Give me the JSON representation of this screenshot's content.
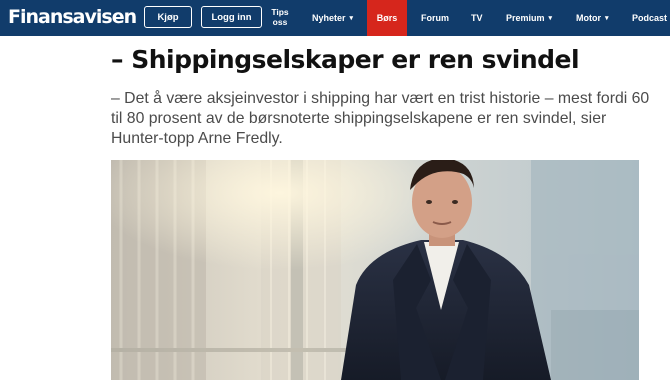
{
  "header": {
    "logo_text": "Finansavisen",
    "buy_label": "Kjøp",
    "login_label": "Logg inn",
    "tips_line1": "Tips",
    "tips_line2": "oss"
  },
  "nav": {
    "items": [
      {
        "label": "Nyheter",
        "has_dropdown": true
      },
      {
        "label": "Børs",
        "has_dropdown": false,
        "active": true
      },
      {
        "label": "Forum",
        "has_dropdown": false
      },
      {
        "label": "TV",
        "has_dropdown": false
      },
      {
        "label": "Premium",
        "has_dropdown": true
      },
      {
        "label": "Motor",
        "has_dropdown": true
      },
      {
        "label": "Podcast",
        "has_dropdown": false
      }
    ],
    "chevron_glyph": "▾"
  },
  "article": {
    "headline": "– Shippingselskaper er ren svindel",
    "ingress": "– Det å være aksjeinvestor i shipping har vært en trist historie – mest fordi 60 til 80 prosent av de børsnoterte shippingselskapene er ren svindel, sier Hunter-topp Arne Fredly."
  },
  "colors": {
    "header_bg": "#113c6b",
    "active_tab": "#d6261c",
    "headline_text": "#111111",
    "ingress_text": "#4b4b4b"
  },
  "icons": [
    "chevron-down-icon"
  ]
}
